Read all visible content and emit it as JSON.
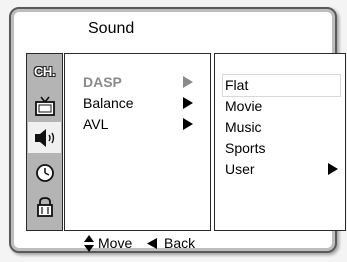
{
  "menu": {
    "title": "Sound",
    "icons": [
      {
        "name": "channel-icon",
        "label": "CH."
      },
      {
        "name": "tv-icon"
      },
      {
        "name": "speaker-icon",
        "active": true
      },
      {
        "name": "clock-icon"
      },
      {
        "name": "lock-icon"
      }
    ],
    "items": [
      {
        "label": "DASP",
        "selected": true,
        "has_submenu": true
      },
      {
        "label": "Balance",
        "has_submenu": true
      },
      {
        "label": "AVL",
        "has_submenu": true
      }
    ],
    "options": [
      {
        "label": "Flat",
        "highlighted": true
      },
      {
        "label": "Movie"
      },
      {
        "label": "Music"
      },
      {
        "label": "Sports"
      },
      {
        "label": "User",
        "has_submenu": true
      }
    ],
    "footer": {
      "move_label": "Move",
      "back_label": "Back"
    }
  }
}
